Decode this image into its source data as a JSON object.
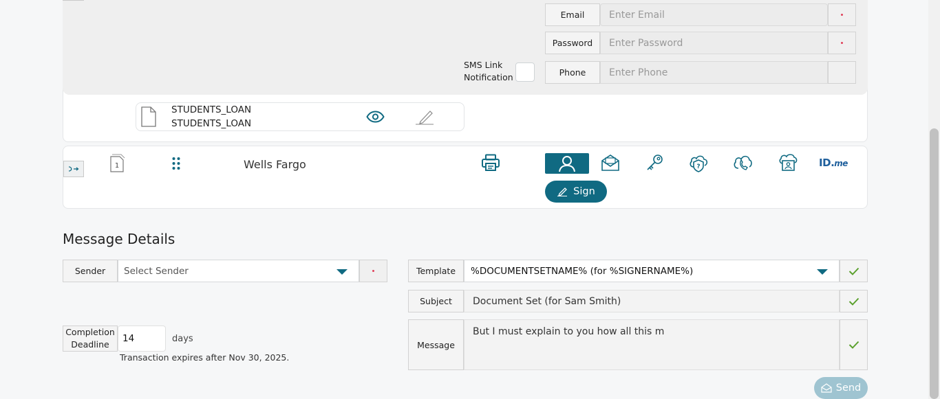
{
  "signer": {
    "email_label": "Email",
    "email_placeholder": "Enter Email",
    "password_label": "Password",
    "password_placeholder": "Enter Password",
    "phone_label": "Phone",
    "phone_placeholder": "Enter Phone",
    "sms_label_line1": "SMS Link",
    "sms_label_line2": "Notification",
    "document": {
      "name_line1": "STUDENTS_LOAN",
      "name_line2": "STUDENTS_LOAN"
    }
  },
  "recipient": {
    "order": "1",
    "name": "Wells Fargo",
    "auth_methods": [
      "person-icon",
      "email-auth-icon",
      "key-auth-icon",
      "question-auth-icon",
      "phone-auth-icon",
      "id-card-auth-icon",
      "idme-icon"
    ],
    "idme_text": "ID.",
    "idme_suffix": "me",
    "sign_label": "Sign"
  },
  "message_details": {
    "title": "Message Details",
    "sender_label": "Sender",
    "sender_placeholder": "Select Sender",
    "template_label": "Template",
    "template_value": "%DOCUMENTSETNAME% (for %SIGNERNAME%)",
    "subject_label": "Subject",
    "subject_value": "Document Set (for Sam Smith)",
    "message_label": "Message",
    "message_value": "But I must explain to you how all this m",
    "completion_label_line1": "Completion",
    "completion_label_line2": "Deadline",
    "completion_days": "14",
    "days_label": "days",
    "expires_text": "Transaction expires after Nov 30, 2025.",
    "send_label": "Send"
  },
  "colors": {
    "accent": "#106a82",
    "check": "#5aa02c",
    "required": "#e0405a",
    "send_disabled": "#9fc4d1"
  }
}
